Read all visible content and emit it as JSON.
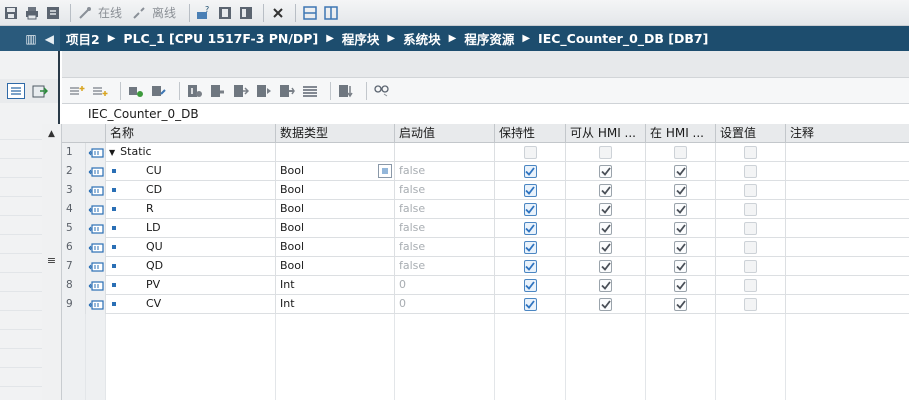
{
  "toolbar": {
    "online_label": "在线",
    "offline_label": "离线"
  },
  "breadcrumb": {
    "items": [
      "项目2",
      "PLC_1 [CPU 1517F-3 PN/DP]",
      "程序块",
      "系统块",
      "程序资源",
      "IEC_Counter_0_DB [DB7]"
    ],
    "separator": "▶"
  },
  "block": {
    "title": "IEC_Counter_0_DB"
  },
  "table": {
    "headers": {
      "name": "名称",
      "datatype": "数据类型",
      "start": "启动值",
      "retain": "保持性",
      "hmi_access": "可从 HMI ...",
      "hmi_visible": "在 HMI ...",
      "setpoint": "设置值",
      "comment": "注释"
    },
    "rows": [
      {
        "num": "1",
        "name": "Static",
        "type": "",
        "start": "",
        "retain": false,
        "hmi1": false,
        "hmi2": false,
        "setpoint": false,
        "kind": "static"
      },
      {
        "num": "2",
        "name": "CU",
        "type": "Bool",
        "start": "false",
        "retain": true,
        "hmi1": true,
        "hmi2": true,
        "setpoint": false,
        "kind": "member",
        "selected": true
      },
      {
        "num": "3",
        "name": "CD",
        "type": "Bool",
        "start": "false",
        "retain": true,
        "hmi1": true,
        "hmi2": true,
        "setpoint": false,
        "kind": "member"
      },
      {
        "num": "4",
        "name": "R",
        "type": "Bool",
        "start": "false",
        "retain": true,
        "hmi1": true,
        "hmi2": true,
        "setpoint": false,
        "kind": "member"
      },
      {
        "num": "5",
        "name": "LD",
        "type": "Bool",
        "start": "false",
        "retain": true,
        "hmi1": true,
        "hmi2": true,
        "setpoint": false,
        "kind": "member"
      },
      {
        "num": "6",
        "name": "QU",
        "type": "Bool",
        "start": "false",
        "retain": true,
        "hmi1": true,
        "hmi2": true,
        "setpoint": false,
        "kind": "member"
      },
      {
        "num": "7",
        "name": "QD",
        "type": "Bool",
        "start": "false",
        "retain": true,
        "hmi1": true,
        "hmi2": true,
        "setpoint": false,
        "kind": "member"
      },
      {
        "num": "8",
        "name": "PV",
        "type": "Int",
        "start": "0",
        "retain": true,
        "hmi1": true,
        "hmi2": true,
        "setpoint": false,
        "kind": "member"
      },
      {
        "num": "9",
        "name": "CV",
        "type": "Int",
        "start": "0",
        "retain": true,
        "hmi1": true,
        "hmi2": true,
        "setpoint": false,
        "kind": "member"
      }
    ]
  },
  "icons": {
    "toolbar": [
      "save-icon",
      "print-icon",
      "compile-icon",
      "go-online-icon",
      "go-offline-icon",
      "accessible-devices-icon",
      "start-cpu-icon",
      "stop-cpu-icon",
      "cross-reference-icon",
      "split-horizontal-icon",
      "split-vertical-icon"
    ],
    "editor": [
      "insert-row-icon",
      "add-row-icon",
      "expand-icon",
      "collapse-icon",
      "snapshot-icon",
      "copy-snapshot-icon",
      "load-start-values-icon",
      "load-snapshot-icon",
      "monitor-icon",
      "list-icon",
      "download-icon",
      "glasses-icon"
    ],
    "row_icon": "db-member-icon"
  },
  "colors": {
    "breadcrumb_bg": "#1d4d6e",
    "checkbox_blue": "#2f74c0",
    "member_dot": "#2a6fb5"
  }
}
